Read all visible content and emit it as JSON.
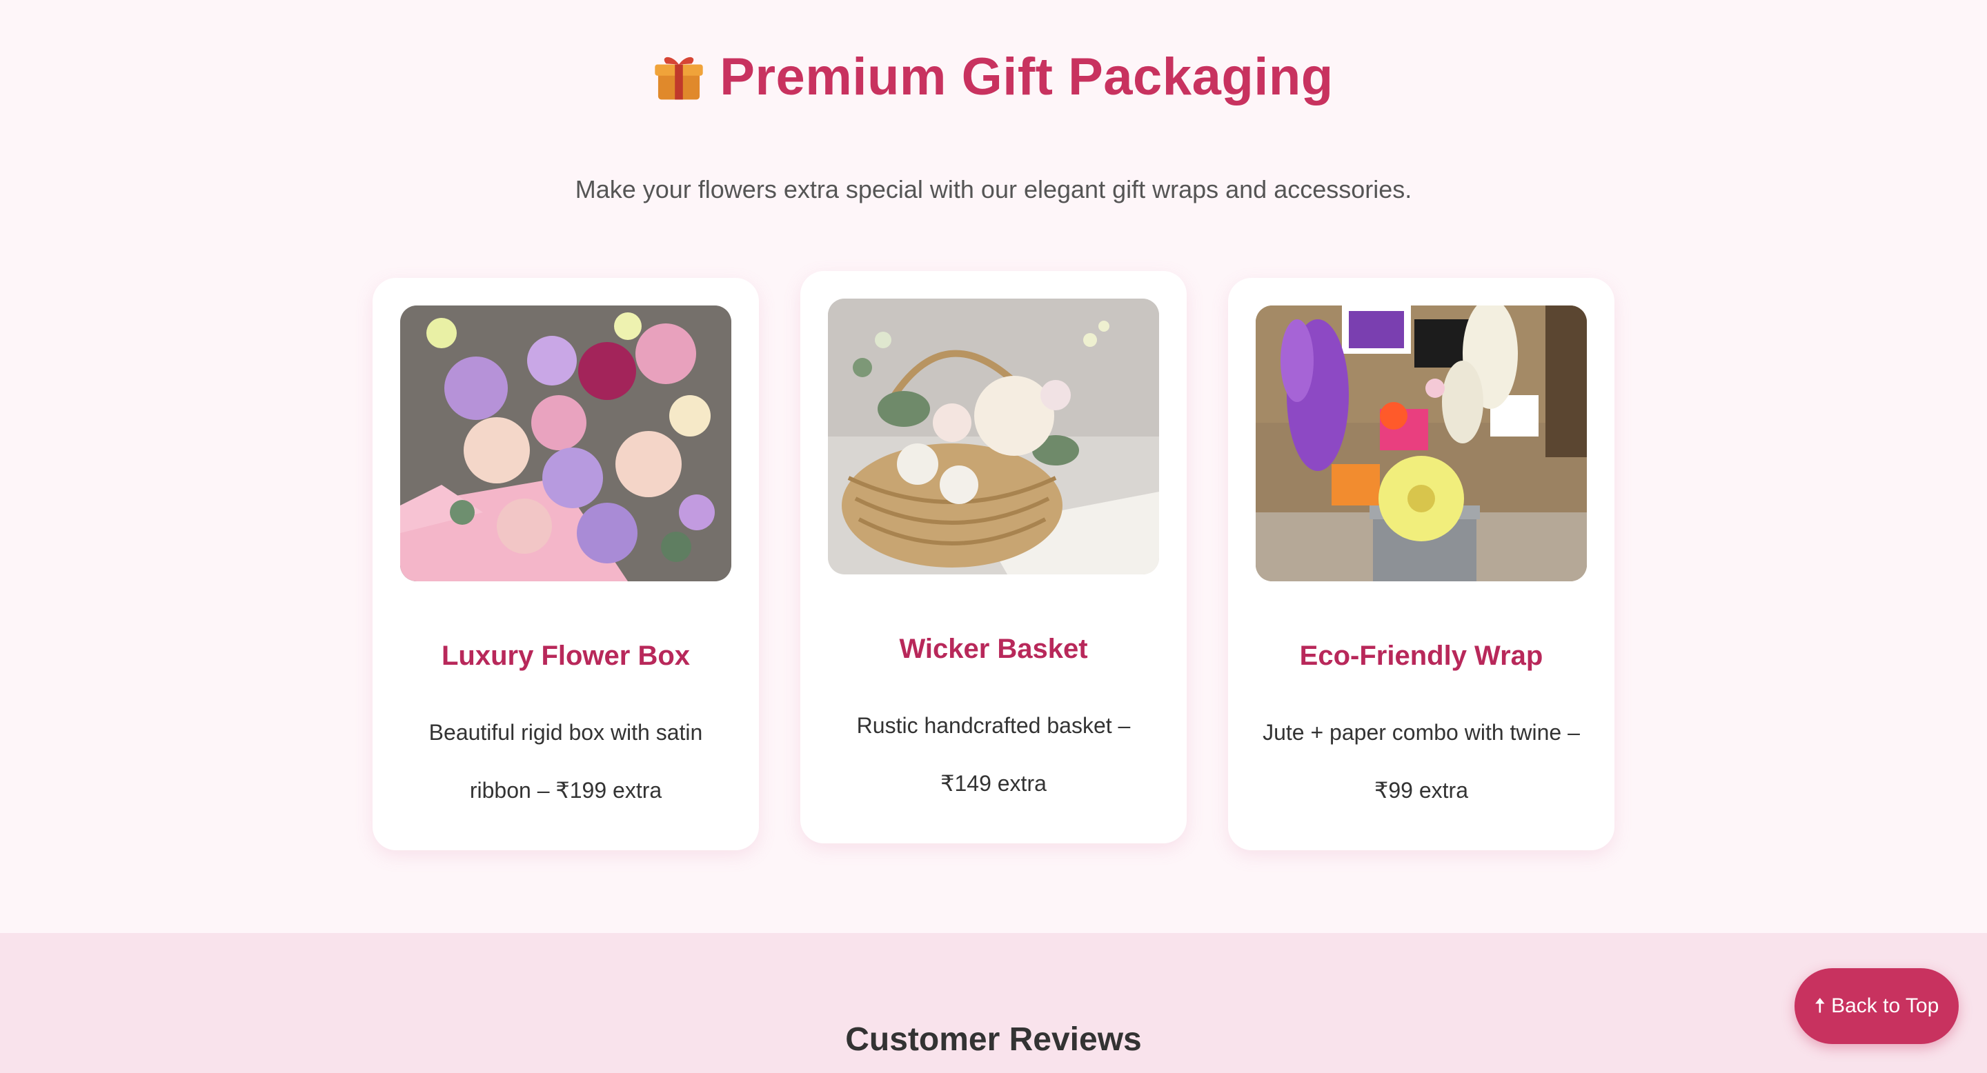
{
  "gift_section": {
    "title": "Premium Gift Packaging",
    "icon": "gift-icon",
    "subtitle": "Make your flowers extra special with our elegant gift wraps and accessories.",
    "cards": [
      {
        "name": "Luxury Flower Box",
        "description": "Beautiful rigid box with satin ribbon – ₹199 extra",
        "image": "flower-box-photo"
      },
      {
        "name": "Wicker Basket",
        "description": "Rustic handcrafted basket – ₹149 extra",
        "image": "wicker-basket-photo"
      },
      {
        "name": "Eco-Friendly Wrap",
        "description": "Jute + paper combo with twine – ₹99 extra",
        "image": "eco-wrap-photo"
      }
    ]
  },
  "reviews_section": {
    "title": "Customer Reviews"
  },
  "back_to_top": {
    "label": "Back to Top",
    "icon": "arrow-up-icon"
  },
  "colors": {
    "accent": "#c8325f",
    "background": "#fef6f9",
    "reviews_background": "#f9e3ec"
  }
}
